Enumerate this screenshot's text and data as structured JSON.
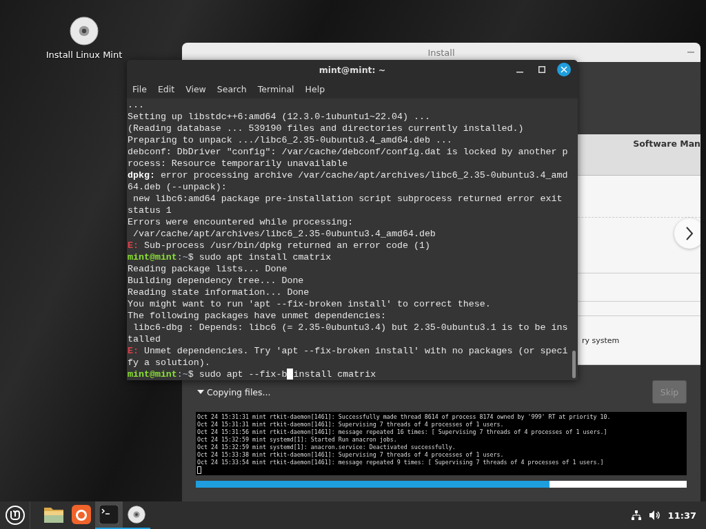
{
  "desktop_icons": [
    {
      "label": "Install Linux Mint"
    }
  ],
  "installer": {
    "title": "Install",
    "slideshow": {
      "heading": "Software Man",
      "text": "ry system"
    },
    "status": {
      "label": "Copying files...",
      "expanded": true
    },
    "skip_button": {
      "label": "Skip",
      "disabled": true
    },
    "log": [
      "Oct 24 15:31:31 mint rtkit-daemon[1461]: Successfully made thread 8614 of process 8174 owned by '999' RT at priority 10.",
      "Oct 24 15:31:31 mint rtkit-daemon[1461]: Supervising 7 threads of 4 processes of 1 users.",
      "Oct 24 15:31:56 mint rtkit-daemon[1461]: message repeated 16 times: [ Supervising 7 threads of 4 processes of 1 users.]",
      "Oct 24 15:32:59 mint systemd[1]: Started Run anacron jobs.",
      "Oct 24 15:32:59 mint systemd[1]: anacron.service: Deactivated successfully.",
      "Oct 24 15:33:38 mint rtkit-daemon[1461]: Supervising 7 threads of 4 processes of 1 users.",
      "Oct 24 15:33:54 mint rtkit-daemon[1461]: message repeated 9 times: [ Supervising 7 threads of 4 processes of 1 users.]"
    ],
    "progress": {
      "level": 0.72
    }
  },
  "terminal": {
    "title": "mint@mint: ~",
    "menu": [
      "File",
      "Edit",
      "View",
      "Search",
      "Terminal",
      "Help"
    ],
    "lines": [
      [
        {
          "kind": "text",
          "text": "..."
        }
      ],
      [
        {
          "kind": "text",
          "text": "Setting up libstdc++6:amd64 (12.3.0-1ubuntu1~22.04) ..."
        }
      ],
      [
        {
          "kind": "text",
          "text": "(Reading database ... 539190 files and directories currently installed.)"
        }
      ],
      [
        {
          "kind": "text",
          "text": "Preparing to unpack .../libc6_2.35-0ubuntu3.4_amd64.deb ..."
        }
      ],
      [
        {
          "kind": "text",
          "text": "debconf: DbDriver \"config\": /var/cache/debconf/config.dat is locked by another p"
        }
      ],
      [
        {
          "kind": "text",
          "text": "rocess: Resource temporarily unavailable"
        }
      ],
      [
        {
          "kind": "bold",
          "text": "dpkg:"
        },
        {
          "kind": "text",
          "text": " error processing archive /var/cache/apt/archives/libc6_2.35-0ubuntu3.4_amd"
        }
      ],
      [
        {
          "kind": "text",
          "text": "64.deb (--unpack):"
        }
      ],
      [
        {
          "kind": "text",
          "text": " new libc6:amd64 package pre-installation script subprocess returned error exit"
        }
      ],
      [
        {
          "kind": "text",
          "text": "status 1"
        }
      ],
      [
        {
          "kind": "text",
          "text": "Errors were encountered while processing:"
        }
      ],
      [
        {
          "kind": "text",
          "text": " /var/cache/apt/archives/libc6_2.35-0ubuntu3.4_amd64.deb"
        }
      ],
      [
        {
          "kind": "error",
          "text": "E:"
        },
        {
          "kind": "text",
          "text": " Sub-process /usr/bin/dpkg returned an error code (1)"
        }
      ],
      [
        {
          "kind": "user",
          "text": "mint@mint"
        },
        {
          "kind": "path",
          "text": ":~"
        },
        {
          "kind": "text",
          "text": "$ sudo apt install cmatrix"
        }
      ],
      [
        {
          "kind": "text",
          "text": "Reading package lists... Done"
        }
      ],
      [
        {
          "kind": "text",
          "text": "Building dependency tree... Done"
        }
      ],
      [
        {
          "kind": "text",
          "text": "Reading state information... Done"
        }
      ],
      [
        {
          "kind": "text",
          "text": "You might want to run 'apt --fix-broken install' to correct these."
        }
      ],
      [
        {
          "kind": "text",
          "text": "The following packages have unmet dependencies:"
        }
      ],
      [
        {
          "kind": "text",
          "text": " libc6-dbg : Depends: libc6 (= 2.35-0ubuntu3.4) but 2.35-0ubuntu3.1 is to be ins"
        }
      ],
      [
        {
          "kind": "text",
          "text": "talled"
        }
      ],
      [
        {
          "kind": "error",
          "text": "E:"
        },
        {
          "kind": "text",
          "text": " Unmet dependencies. Try 'apt --fix-broken install' with no packages (or speci"
        }
      ],
      [
        {
          "kind": "text",
          "text": "fy a solution)."
        }
      ],
      [
        {
          "kind": "user",
          "text": "mint@mint"
        },
        {
          "kind": "path",
          "text": ":~"
        },
        {
          "kind": "text",
          "text": "$ sudo apt --fix-b"
        },
        {
          "kind": "cursor"
        },
        {
          "kind": "text",
          "text": "install cmatrix"
        }
      ]
    ]
  },
  "taskbar": {
    "items": [
      {
        "kind": "folder",
        "running": false,
        "selected": false
      },
      {
        "kind": "browser",
        "running": false,
        "selected": false
      },
      {
        "kind": "terminal",
        "running": true,
        "selected": true
      },
      {
        "kind": "disc",
        "running": true,
        "selected": false
      }
    ],
    "clock": "11:37"
  }
}
